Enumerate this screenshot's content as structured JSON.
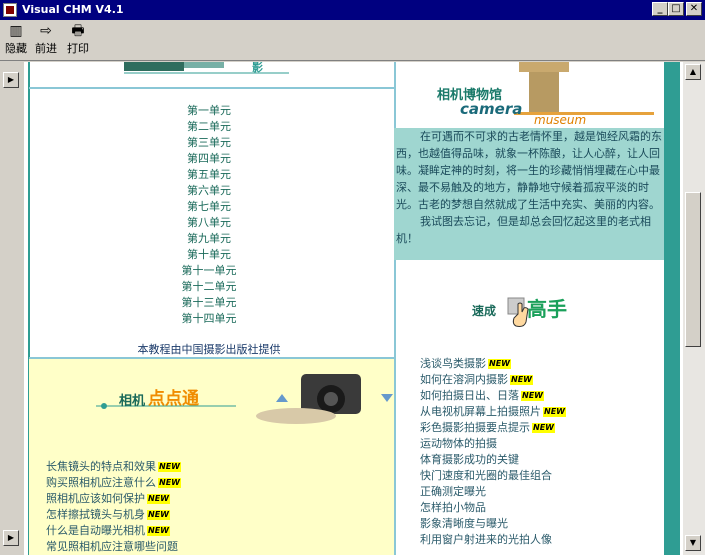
{
  "window": {
    "title": "Visual CHM V4.1"
  },
  "toolbar": {
    "hide_label": "隐藏",
    "forward_label": "前进",
    "print_label": "打印"
  },
  "units": [
    "第一单元",
    "第二单元",
    "第三单元",
    "第四单元",
    "第五单元",
    "第六单元",
    "第七单元",
    "第八单元",
    "第九单元",
    "第十单元",
    "第十一单元",
    "第十二单元",
    "第十三单元",
    "第十四单元"
  ],
  "credit": "本教程由中国摄影出版社提供",
  "top_banner": {
    "text": "影"
  },
  "museum": {
    "title_cn": "相机博物馆",
    "title_en": "camera",
    "subtitle": "museum"
  },
  "intro": {
    "paragraphs": [
      "在可遇而不可求的古老情怀里，越是饱经风霜的东西，也越值得品味，就象一杯陈酿，让人心醉，让人回味。凝眸定神的时刻，将一生的珍藏悄悄埋藏在心中最深、最不易触及的地方，静静地守候着孤寂平淡的时光。古老的梦想自然就成了生活中充实、美丽的内容。",
      "我试图去忘记，但是却总会回忆起这里的老式相机！"
    ]
  },
  "fast_master": {
    "label_small": "速成",
    "label_big": "高手"
  },
  "tips_banner": {
    "prefix": "相机",
    "highlight": "点点通"
  },
  "tips": [
    {
      "text": "长焦镜头的特点和效果",
      "new": "NEW"
    },
    {
      "text": "购买照相机应注意什么",
      "new": "NEW"
    },
    {
      "text": "照相机应该如何保护",
      "new": "NEW"
    },
    {
      "text": "怎样擦拭镜头与机身",
      "new": "NEW"
    },
    {
      "text": "什么是自动曝光相机",
      "new": "NEW"
    },
    {
      "text": "常见照相机应注意哪些问题",
      "new": ""
    }
  ],
  "fast_items": [
    {
      "text": "浅谈鸟类摄影",
      "new": "NEW"
    },
    {
      "text": "如何在溶洞内摄影",
      "new": "NEW"
    },
    {
      "text": "如何拍摄日出、日落",
      "new": "NEW"
    },
    {
      "text": "从电视机屏幕上拍摄照片",
      "new": "NEW"
    },
    {
      "text": "彩色摄影拍摄要点提示",
      "new": "NEW"
    },
    {
      "text": "运动物体的拍摄",
      "new": ""
    },
    {
      "text": "体育摄影成功的关键",
      "new": ""
    },
    {
      "text": "快门速度和光圈的最佳组合",
      "new": ""
    },
    {
      "text": "正确测定曝光",
      "new": ""
    },
    {
      "text": "怎样拍小物品",
      "new": ""
    },
    {
      "text": "影象清晰度与曝光",
      "new": ""
    },
    {
      "text": "利用窗户射进来的光拍人像",
      "new": ""
    }
  ],
  "colors": {
    "titlebar": "#000080",
    "teal_border": "#2f9d93",
    "intro_bg": "#9fd6d0",
    "tip_bg": "#ffffc8",
    "new_badge": "#ffff00"
  }
}
